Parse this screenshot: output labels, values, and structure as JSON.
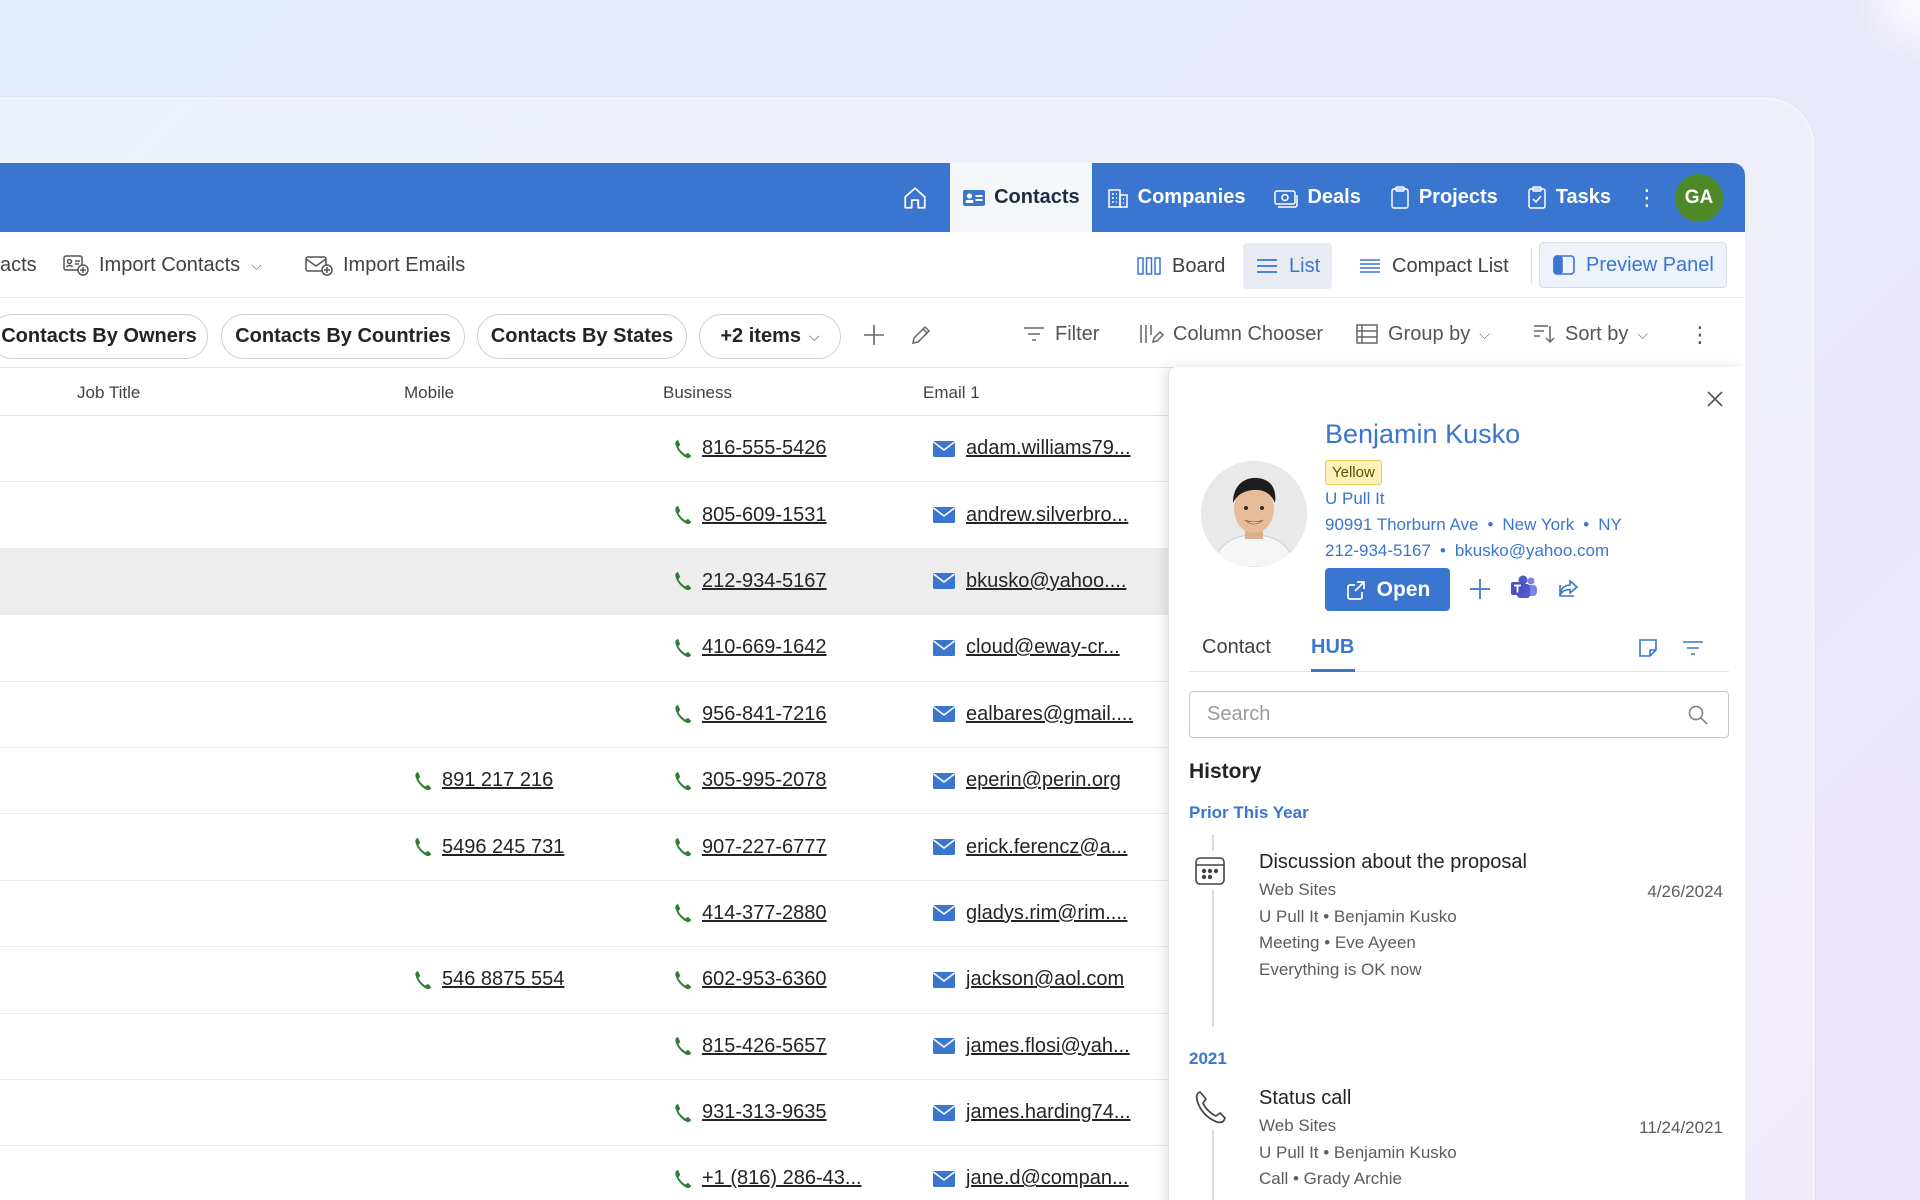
{
  "nav": {
    "items": [
      {
        "label": "Contacts",
        "icon": "contact-card-icon",
        "active": true
      },
      {
        "label": "Companies",
        "icon": "building-icon",
        "active": false
      },
      {
        "label": "Deals",
        "icon": "money-icon",
        "active": false
      },
      {
        "label": "Projects",
        "icon": "clipboard-icon",
        "active": false
      },
      {
        "label": "Tasks",
        "icon": "task-check-icon",
        "active": false
      }
    ],
    "more": "⋮",
    "avatar_initials": "GA",
    "colors": {
      "bar": "#3a76cf",
      "avatar": "#4d8a27"
    }
  },
  "toolbar": {
    "cut_label": "acts",
    "import_contacts": "Import Contacts",
    "import_emails": "Import Emails",
    "board": "Board",
    "list": "List",
    "compact_list": "Compact List",
    "preview_panel": "Preview Panel"
  },
  "views": {
    "pills": [
      "Contacts By Owners",
      "Contacts By Countries",
      "Contacts By States",
      "+2 items"
    ],
    "filter": "Filter",
    "column_chooser": "Column Chooser",
    "group_by": "Group by",
    "sort_by": "Sort by"
  },
  "grid": {
    "columns": {
      "job_title": "Job Title",
      "mobile": "Mobile",
      "business": "Business",
      "email": "Email 1"
    },
    "rows": [
      {
        "mobile": "",
        "business": "816-555-5426",
        "email": "adam.williams79..."
      },
      {
        "mobile": "",
        "business": "805-609-1531",
        "email": "andrew.silverbro..."
      },
      {
        "mobile": "",
        "business": "212-934-5167",
        "email": "bkusko@yahoo...."
      },
      {
        "mobile": "",
        "business": "410-669-1642",
        "email": "cloud@eway-cr..."
      },
      {
        "mobile": "",
        "business": "956-841-7216",
        "email": "ealbares@gmail...."
      },
      {
        "mobile": "891 217 216",
        "business": "305-995-2078",
        "email": "eperin@perin.org"
      },
      {
        "mobile": "5496 245 731",
        "business": "907-227-6777",
        "email": "erick.ferencz@a..."
      },
      {
        "mobile": "",
        "business": "414-377-2880",
        "email": "gladys.rim@rim...."
      },
      {
        "mobile": "546 8875 554",
        "business": "602-953-6360",
        "email": "jackson@aol.com"
      },
      {
        "mobile": "",
        "business": "815-426-5657",
        "email": "james.flosi@yah..."
      },
      {
        "mobile": "",
        "business": "931-313-9635",
        "email": "james.harding74..."
      },
      {
        "mobile": "",
        "business": "+1 (816) 286-43...",
        "email": "jane.d@compan..."
      }
    ],
    "selected_row": 2,
    "colors": {
      "phone": "#2e7d32",
      "mail": "#3a76cf"
    }
  },
  "panel": {
    "name": "Benjamin Kusko",
    "badge": "Yellow",
    "company": "U Pull It",
    "street": "90991 Thorburn Ave",
    "city": "New York",
    "state": "NY",
    "phone": "212-934-5167",
    "email": "bkusko@yahoo.com",
    "open_label": "Open",
    "tabs": [
      "Contact",
      "HUB"
    ],
    "active_tab": "HUB",
    "search_placeholder": "Search",
    "history_title": "History",
    "groups": [
      {
        "label": "Prior This Year",
        "events": [
          {
            "icon": "calendar-icon",
            "title": "Discussion about the proposal",
            "source": "Web Sites",
            "date": "4/26/2024",
            "related": "U Pull It • Benjamin Kusko",
            "type": "Meeting • Eve Ayeen",
            "note": "Everything is OK now"
          }
        ]
      },
      {
        "label": "2021",
        "events": [
          {
            "icon": "phone-icon",
            "title": "Status call",
            "source": "Web Sites",
            "date": "11/24/2021",
            "related": "U Pull It • Benjamin Kusko",
            "type": "Call • Grady Archie"
          }
        ]
      }
    ]
  }
}
